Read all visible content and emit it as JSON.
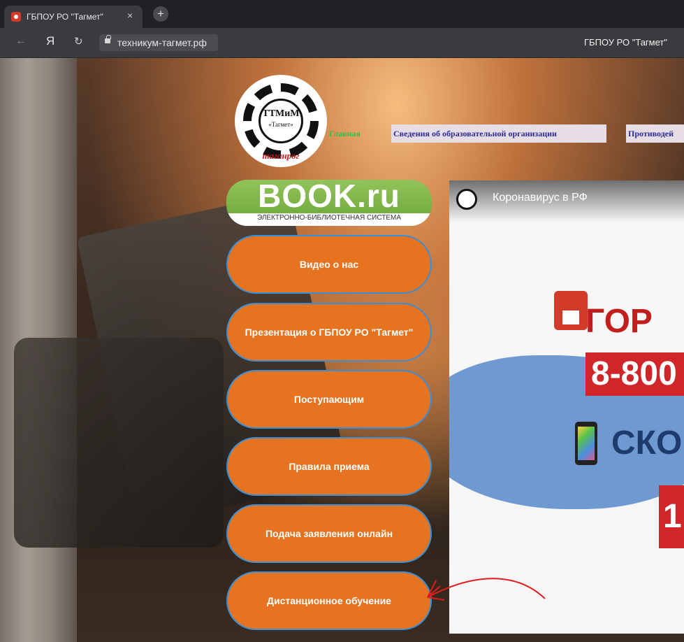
{
  "browser": {
    "tab_title": "ГБПОУ РО \"Тагмет\"",
    "tab_close": "×",
    "new_tab": "+",
    "back": "←",
    "ya": "Я",
    "reload": "↻",
    "url": "техникум-тагмет.рф",
    "page_title": "ГБПОУ РО \"Тагмет\""
  },
  "logo": {
    "main": "ТТМиМ",
    "sub": "«Тагмет»",
    "city": "таганрог"
  },
  "menu": {
    "home": "Главная",
    "info": "Сведения об образовательной организации",
    "fire": "Противодей"
  },
  "bookru": {
    "title": "BOOK.ru",
    "subtitle": "ЭЛЕКТРОННО-БИБЛИОТЕЧНАЯ СИСТЕМА"
  },
  "buttons": [
    {
      "label": "Видео о нас"
    },
    {
      "label": "Презентация о ГБПОУ РО \"Тагмет\""
    },
    {
      "label": "Поступающим"
    },
    {
      "label": "Правила приема"
    },
    {
      "label": "Подача заявления онлайн"
    },
    {
      "label": "Дистанционное обучение"
    }
  ],
  "video": {
    "title": "Коронавирус в РФ",
    "line1": "ГОР",
    "line2": "8-800",
    "line3": "СКО",
    "line4": "1"
  },
  "colors": {
    "button_bg": "#e6731f",
    "button_border": "#3b8fd6",
    "home_link": "#2ec04c",
    "menu_link": "#2b2b9a",
    "bookru_green": "#7ab346",
    "annotation_red": "#e01b1b"
  }
}
